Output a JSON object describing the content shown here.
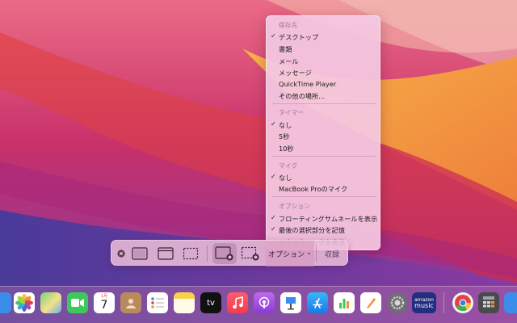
{
  "toolbar": {
    "options_label": "オプション",
    "options_chevron": "⌄",
    "capture_label": "収録",
    "buttons": [
      {
        "name": "close-icon"
      },
      {
        "name": "capture-entire-screen-icon"
      },
      {
        "name": "capture-selected-window-icon"
      },
      {
        "name": "capture-selected-portion-icon"
      },
      {
        "name": "record-entire-screen-icon"
      },
      {
        "name": "record-selected-portion-icon"
      }
    ]
  },
  "menu": {
    "save_to": {
      "header": "保存先",
      "items": [
        "デスクトップ",
        "書類",
        "メール",
        "メッセージ",
        "QuickTime Player",
        "その他の場所..."
      ]
    },
    "timer": {
      "header": "タイマー",
      "items": [
        "なし",
        "5秒",
        "10秒"
      ]
    },
    "mic": {
      "header": "マイク",
      "items": [
        "なし",
        "MacBook Proのマイク"
      ]
    },
    "options": {
      "header": "オプション",
      "items": [
        "フローティングサムネールを表示",
        "最後の選択部分を記憶",
        "マウスクリックを表示"
      ]
    },
    "check_glyph": "✓"
  },
  "dock": {
    "calendar_month": "1月",
    "calendar_day": "7",
    "tv_label": "tv",
    "amazon_music_label_1": "amazon",
    "amazon_music_label_2": "music",
    "apps": [
      "finder-icon",
      "photos-icon",
      "maps-icon",
      "facetime-icon",
      "calendar-icon",
      "contacts-icon",
      "reminders-icon",
      "notes-icon",
      "apple-tv-icon",
      "music-icon",
      "podcasts-icon",
      "keynote-icon",
      "app-store-icon",
      "numbers-icon",
      "pages-icon",
      "system-preferences-icon",
      "amazon-music-icon",
      "chrome-icon",
      "calculator-icon",
      "finder-partial-icon"
    ]
  },
  "colors": {
    "wallpaper_orange": "#f5a33a",
    "wallpaper_red": "#d7344f",
    "wallpaper_magenta": "#b8306e",
    "wallpaper_purple": "#5a3a9a"
  }
}
